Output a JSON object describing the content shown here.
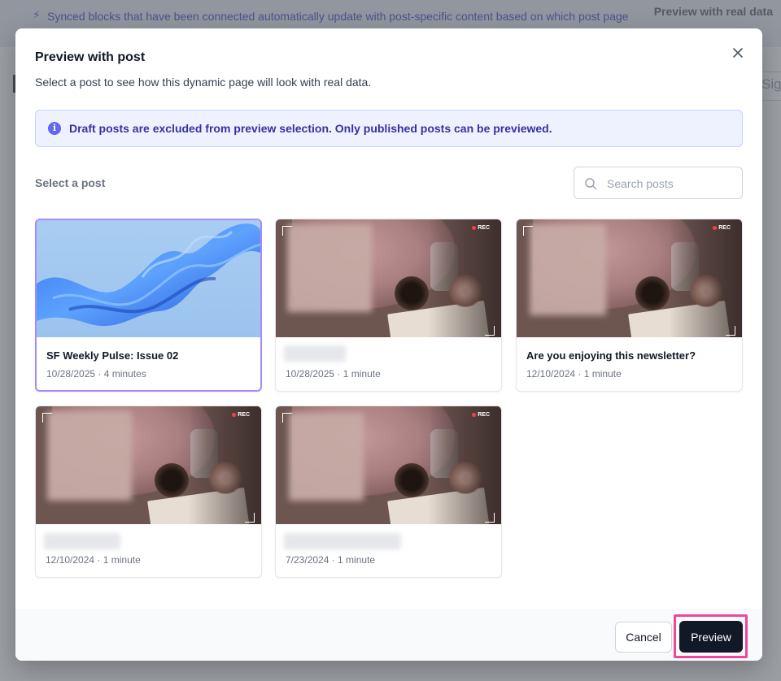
{
  "background": {
    "banner_icon": "lightning-bolt-icon",
    "banner_text": "Synced blocks that have been connected automatically update with post-specific content based on which post page someone visits on your published site.",
    "top_right_link": "Preview with real data",
    "right_edge_text": "Sig"
  },
  "modal": {
    "title": "Preview with post",
    "subtitle": "Select a post to see how this dynamic page will look with real data.",
    "close_icon": "close-icon",
    "info_banner": {
      "icon": "info-icon",
      "icon_glyph": "i",
      "text": "Draft posts are excluded from preview selection. Only published posts can be previewed."
    },
    "select_label": "Select a post",
    "search": {
      "placeholder": "Search posts",
      "value": "",
      "icon": "search-icon"
    },
    "posts": [
      {
        "title": "SF Weekly Pulse: Issue 02",
        "meta": "10/28/2025 · 4 minutes",
        "thumbnail": "abstract-blue-ribbon",
        "selected": true,
        "title_redacted": false
      },
      {
        "title": "",
        "meta": "10/28/2025 · 1 minute",
        "thumbnail": "cozy-photo",
        "selected": false,
        "title_redacted": true
      },
      {
        "title": "Are you enjoying this newsletter?",
        "meta": "12/10/2024 · 1 minute",
        "thumbnail": "cozy-photo",
        "selected": false,
        "title_redacted": false
      },
      {
        "title": "",
        "meta": "12/10/2024 · 1 minute",
        "thumbnail": "cozy-photo",
        "selected": false,
        "title_redacted": true
      },
      {
        "title": "",
        "meta": "7/23/2024 · 1 minute",
        "thumbnail": "cozy-photo",
        "selected": false,
        "title_redacted": true
      }
    ],
    "rec_label": "REC",
    "footer": {
      "cancel_label": "Cancel",
      "preview_label": "Preview"
    }
  },
  "colors": {
    "accent_selected_border": "#a78bfa",
    "primary_button": "#111827",
    "highlight": "#ec4899",
    "info_bg": "#eef2ff",
    "info_text": "#3730a3"
  }
}
